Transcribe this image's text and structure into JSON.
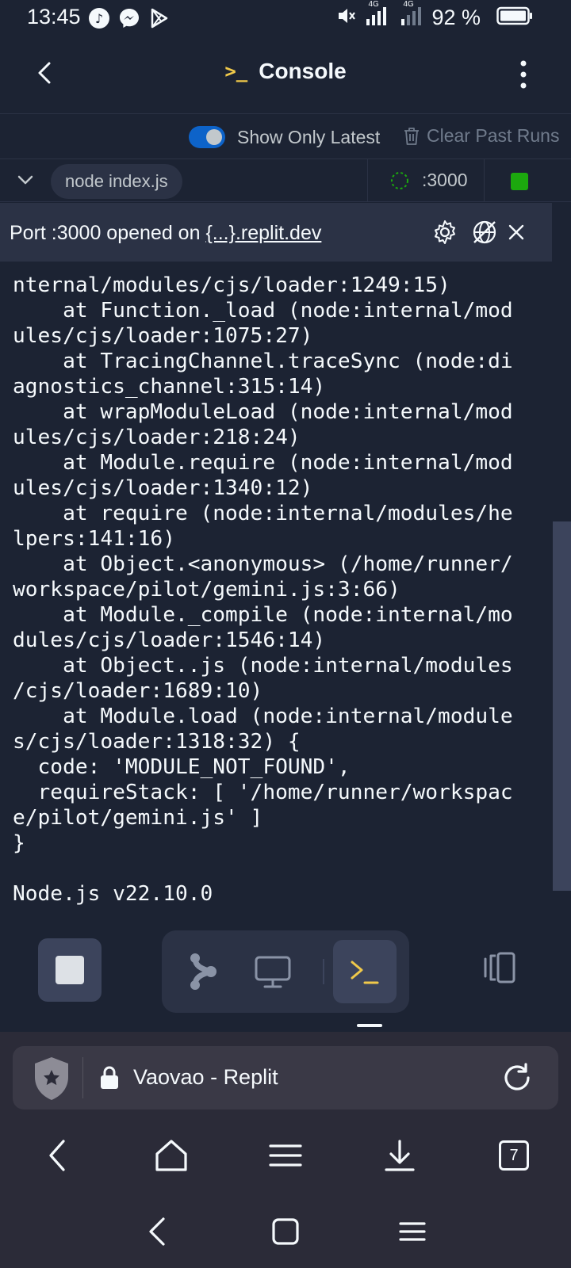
{
  "status_bar": {
    "time": "13:45",
    "battery_percent": "92 %",
    "network_label_1": "4G",
    "network_label_2": "4G"
  },
  "header": {
    "title": "Console",
    "title_icon": ">_"
  },
  "toolbar": {
    "toggle_label": "Show Only Latest",
    "toggle_on": true,
    "clear_label": "Clear Past Runs"
  },
  "run": {
    "command": "node index.js",
    "port": ":3000",
    "status_color": "#1ca80e"
  },
  "port_banner": {
    "prefix": "Port :3000 opened on ",
    "link": "{...}.replit.dev"
  },
  "console": {
    "output": "nternal/modules/cjs/loader:1249:15)\n    at Function._load (node:internal/mod\nules/cjs/loader:1075:27)\n    at TracingChannel.traceSync (node:di\nagnostics_channel:315:14)\n    at wrapModuleLoad (node:internal/mod\nules/cjs/loader:218:24)\n    at Module.require (node:internal/mod\nules/cjs/loader:1340:12)\n    at require (node:internal/modules/he\nlpers:141:16)\n    at Object.<anonymous> (/home/runner/\nworkspace/pilot/gemini.js:3:66)\n    at Module._compile (node:internal/mo\ndules/cjs/loader:1546:14)\n    at Object..js (node:internal/modules\n/cjs/loader:1689:10)\n    at Module.load (node:internal/module\ns/cjs/loader:1318:32) {\n  code: 'MODULE_NOT_FOUND',\n  requireStack: [ '/home/runner/workspac\ne/pilot/gemini.js' ]\n}\n\nNode.js v22.10.0"
  },
  "browser": {
    "page_title": "Vaovao - Replit",
    "tab_count": "7"
  },
  "colors": {
    "background": "#1c2333",
    "panel": "#2b3245",
    "accent_yellow": "#f0c94a",
    "toggle_blue": "#0d63c9",
    "running_green": "#1ca80e"
  }
}
